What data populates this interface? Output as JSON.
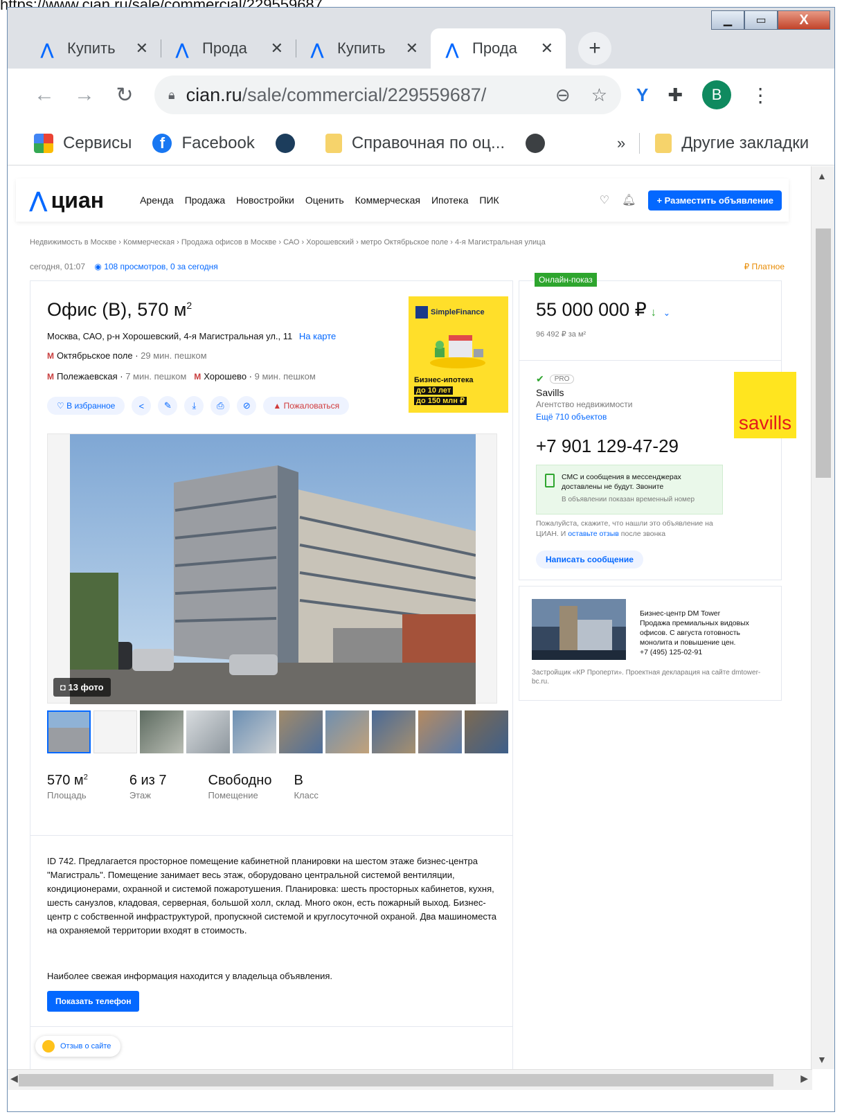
{
  "caption_url": "https://www.cian.ru/sale/commercial/229559687",
  "browser": {
    "window_buttons": {
      "minimize": "▁",
      "maximize": "▭",
      "close": "X"
    },
    "tabs": [
      {
        "title": "Купить",
        "active": false
      },
      {
        "title": "Прода",
        "active": false
      },
      {
        "title": "Купить",
        "active": false
      },
      {
        "title": "Прода",
        "active": true
      }
    ],
    "tab_close": "✕",
    "new_tab": "+",
    "url_domain": "cian.ru",
    "url_path": "/sale/commercial/229559687/",
    "avatar_letter": "B",
    "bookmarks": [
      "Сервисы",
      "Facebook",
      "Справочная по оц...",
      "Другие закладки"
    ],
    "bookmarks_more": "»"
  },
  "site": {
    "logo_text": "циан",
    "nav": [
      "Аренда",
      "Продажа",
      "Новостройки",
      "Оценить",
      "Коммерческая",
      "Ипотека",
      "ПИК"
    ],
    "post_button": "+ Разместить объявление"
  },
  "breadcrumbs": [
    "Недвижимость в Москве",
    "Коммерческая",
    "Продажа офисов в Москве",
    "САО",
    "Хорошевский",
    "метро Октябрьское поле",
    "4-я Магистральная улица"
  ],
  "meta": {
    "date": "сегодня, 01:07",
    "views": "108 просмотров, 0 за сегодня",
    "paid": "Платное"
  },
  "listing": {
    "title": "Офис (B), 570 м",
    "title_sup": "2",
    "address": "Москва, САО, р-н Хорошевский, 4-я Магистральная ул., 11",
    "map_link": "На карте",
    "metro": [
      {
        "name": "Октябрьское поле",
        "walk": "29 мин. пешком"
      },
      {
        "name": "Полежаевская",
        "walk": "7 мин. пешком"
      },
      {
        "name": "Хорошево",
        "walk": "9 мин. пешком"
      }
    ],
    "favorite": "В избранное",
    "complain": "Пожаловаться",
    "photo_count": "13 фото",
    "facts": [
      {
        "value": "570 м",
        "sup": "2",
        "label": "Площадь"
      },
      {
        "value": "6 из 7",
        "sup": "",
        "label": "Этаж"
      },
      {
        "value": "Свободно",
        "sup": "",
        "label": "Помещение"
      },
      {
        "value": "B",
        "sup": "",
        "label": "Класс"
      }
    ],
    "description": "ID 742. Предлагается просторное помещение кабинетной планировки на шестом этаже бизнес-центра \"Магистраль\". Помещение занимает весь этаж, оборудовано центральной системой вентиляции, кондиционерами, охранной и системой пожаротушения. Планировка: шесть просторных кабинетов, кухня, шесть санузлов, кладовая, серверная, большой холл, склад. Много окон, есть пожарный выход. Бизнес-центр с собственной инфраструктурой, пропускной системой и круглосуточной охраной. Два машиноместа на охраняемой территории входят в стоимость.",
    "note": "Наиболее свежая информация находится у владельца объявления.",
    "show_phone": "Показать телефон",
    "feedback": "Отзыв о сайте"
  },
  "ad": {
    "brand": "SimpleFinance",
    "line1": "Бизнес-ипотека",
    "line2": "до 10 лет",
    "line3": "до 150 млн ₽"
  },
  "price": {
    "badge": "Онлайн-показ",
    "value": "55 000 000 ₽",
    "per_m": "96 492 ₽ за м²"
  },
  "agent": {
    "pro": "PRO",
    "name": "Savills",
    "type": "Агентство недвижимости",
    "more": "Ещё 710 объектов",
    "logo_text": "savills",
    "phone": "+7 901 129-47-29",
    "sms_line1": "СМС и сообщения в мессенджерах доставлены не будут. Звоните",
    "sms_line2": "В объявлении показан временный номер",
    "please_1": "Пожалуйста, скажите, что нашли это объявление на ЦИАН. И",
    "please_link": "оставьте отзыв",
    "please_2": "после звонка",
    "write_button": "Написать сообщение"
  },
  "business_center": {
    "name": "Бизнес-центр DM Tower",
    "text": "Продажа премиальных видовых офисов. С августа готовность монолита и повышение цен.",
    "phone": "+7 (495) 125-02-91",
    "footer": "Застройщик «КР Проперти». Проектная декларация на сайте dmtower-bc.ru."
  },
  "colors": {
    "brand_blue": "#0468ff",
    "green": "#2ea52e",
    "metro_red": "#c83e3e",
    "paid_orange": "#e88a00"
  }
}
